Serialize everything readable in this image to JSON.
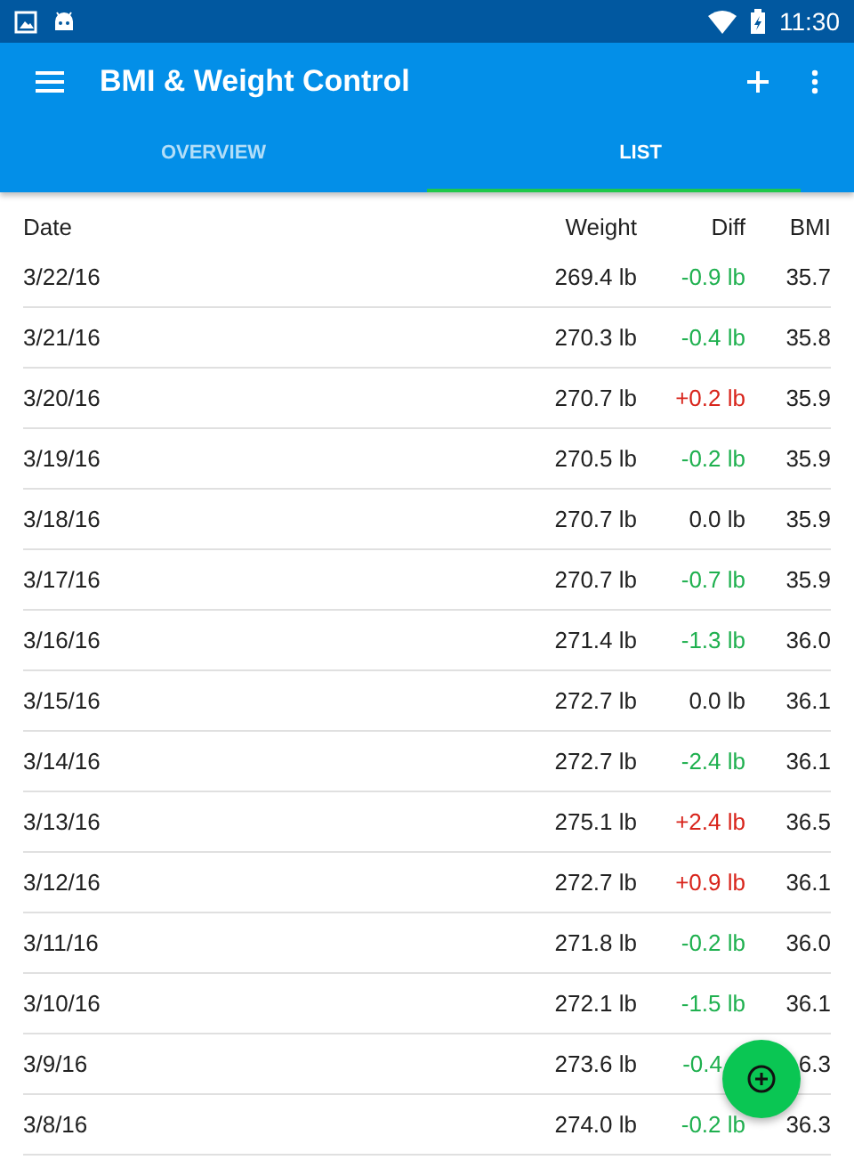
{
  "status_bar": {
    "time": "11:30"
  },
  "app_bar": {
    "title": "BMI & Weight Control"
  },
  "tabs": [
    {
      "label": "OVERVIEW",
      "selected": false
    },
    {
      "label": "LIST",
      "selected": true
    }
  ],
  "table": {
    "columns": [
      "Date",
      "Weight",
      "Diff",
      "BMI"
    ],
    "rows": [
      {
        "date": "3/22/16",
        "weight": "269.4 lb",
        "diff": "-0.9 lb",
        "color": "#1fb04f",
        "bmi": "35.7"
      },
      {
        "date": "3/21/16",
        "weight": "270.3 lb",
        "diff": "-0.4 lb",
        "color": "#1fb04f",
        "bmi": "35.8"
      },
      {
        "date": "3/20/16",
        "weight": "270.7 lb",
        "diff": "+0.2 lb",
        "color": "#d8241b",
        "bmi": "35.9"
      },
      {
        "date": "3/19/16",
        "weight": "270.5 lb",
        "diff": "-0.2 lb",
        "color": "#1fb04f",
        "bmi": "35.9"
      },
      {
        "date": "3/18/16",
        "weight": "270.7 lb",
        "diff": "0.0 lb",
        "color": "#212121",
        "bmi": "35.9"
      },
      {
        "date": "3/17/16",
        "weight": "270.7 lb",
        "diff": "-0.7 lb",
        "color": "#1fb04f",
        "bmi": "35.9"
      },
      {
        "date": "3/16/16",
        "weight": "271.4 lb",
        "diff": "-1.3 lb",
        "color": "#1fb04f",
        "bmi": "36.0"
      },
      {
        "date": "3/15/16",
        "weight": "272.7 lb",
        "diff": "0.0 lb",
        "color": "#212121",
        "bmi": "36.1"
      },
      {
        "date": "3/14/16",
        "weight": "272.7 lb",
        "diff": "-2.4 lb",
        "color": "#1fb04f",
        "bmi": "36.1"
      },
      {
        "date": "3/13/16",
        "weight": "275.1 lb",
        "diff": "+2.4 lb",
        "color": "#d8241b",
        "bmi": "36.5"
      },
      {
        "date": "3/12/16",
        "weight": "272.7 lb",
        "diff": "+0.9 lb",
        "color": "#d8241b",
        "bmi": "36.1"
      },
      {
        "date": "3/11/16",
        "weight": "271.8 lb",
        "diff": "-0.2 lb",
        "color": "#1fb04f",
        "bmi": "36.0"
      },
      {
        "date": "3/10/16",
        "weight": "272.1 lb",
        "diff": "-1.5 lb",
        "color": "#1fb04f",
        "bmi": "36.1"
      },
      {
        "date": "3/9/16",
        "weight": "273.6 lb",
        "diff": "-0.4",
        "color": "#1fb04f",
        "bmi": "6.3"
      },
      {
        "date": "3/8/16",
        "weight": "274.0 lb",
        "diff": "-0.2 lb",
        "color": "#1fb04f",
        "bmi": "36.3"
      }
    ]
  }
}
